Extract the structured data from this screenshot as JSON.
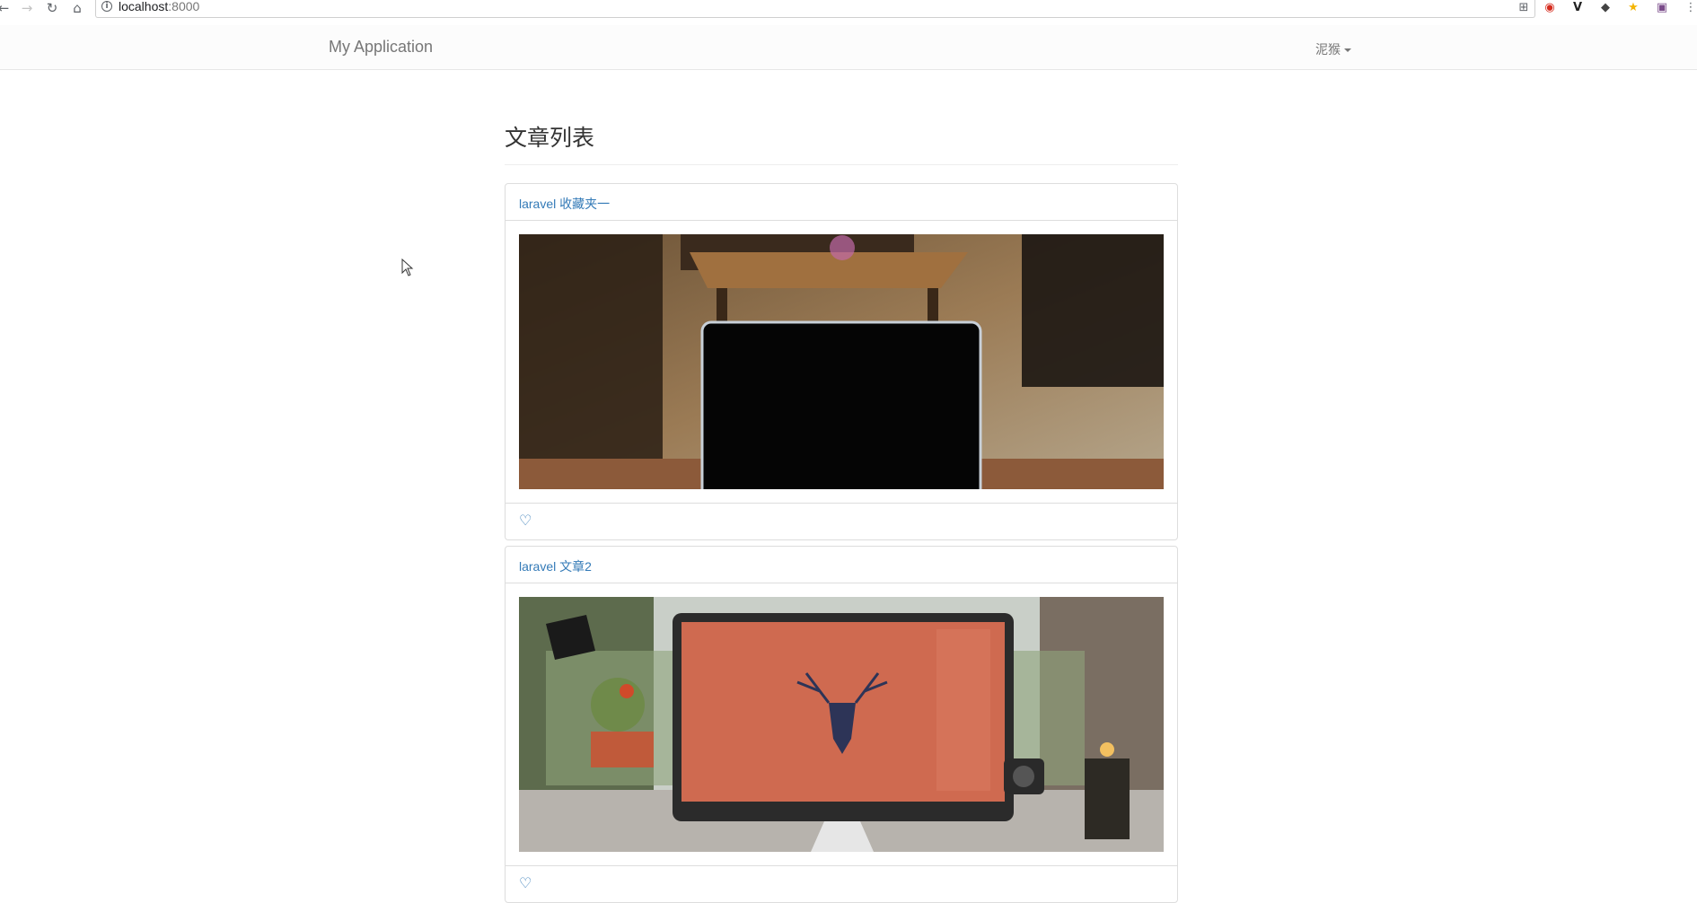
{
  "browser": {
    "back_icon": "arrow-left-icon",
    "forward_icon": "arrow-right-icon",
    "reload_icon": "reload-icon",
    "home_icon": "home-icon",
    "url_host": "localhost",
    "url_port": ":8000"
  },
  "navbar": {
    "brand": "My Application",
    "user": "泥猴"
  },
  "page": {
    "heading": "文章列表"
  },
  "articles": [
    {
      "title": "laravel 收藏夹一",
      "image": "laptop-on-desk-photo",
      "favorite_icon": "heart-outline-icon"
    },
    {
      "title": "laravel 文章2",
      "image": "imac-desk-photo",
      "favorite_icon": "heart-outline-icon"
    }
  ],
  "colors": {
    "link": "#337ab7",
    "navbar_text": "#777777",
    "border": "#dddddd"
  }
}
